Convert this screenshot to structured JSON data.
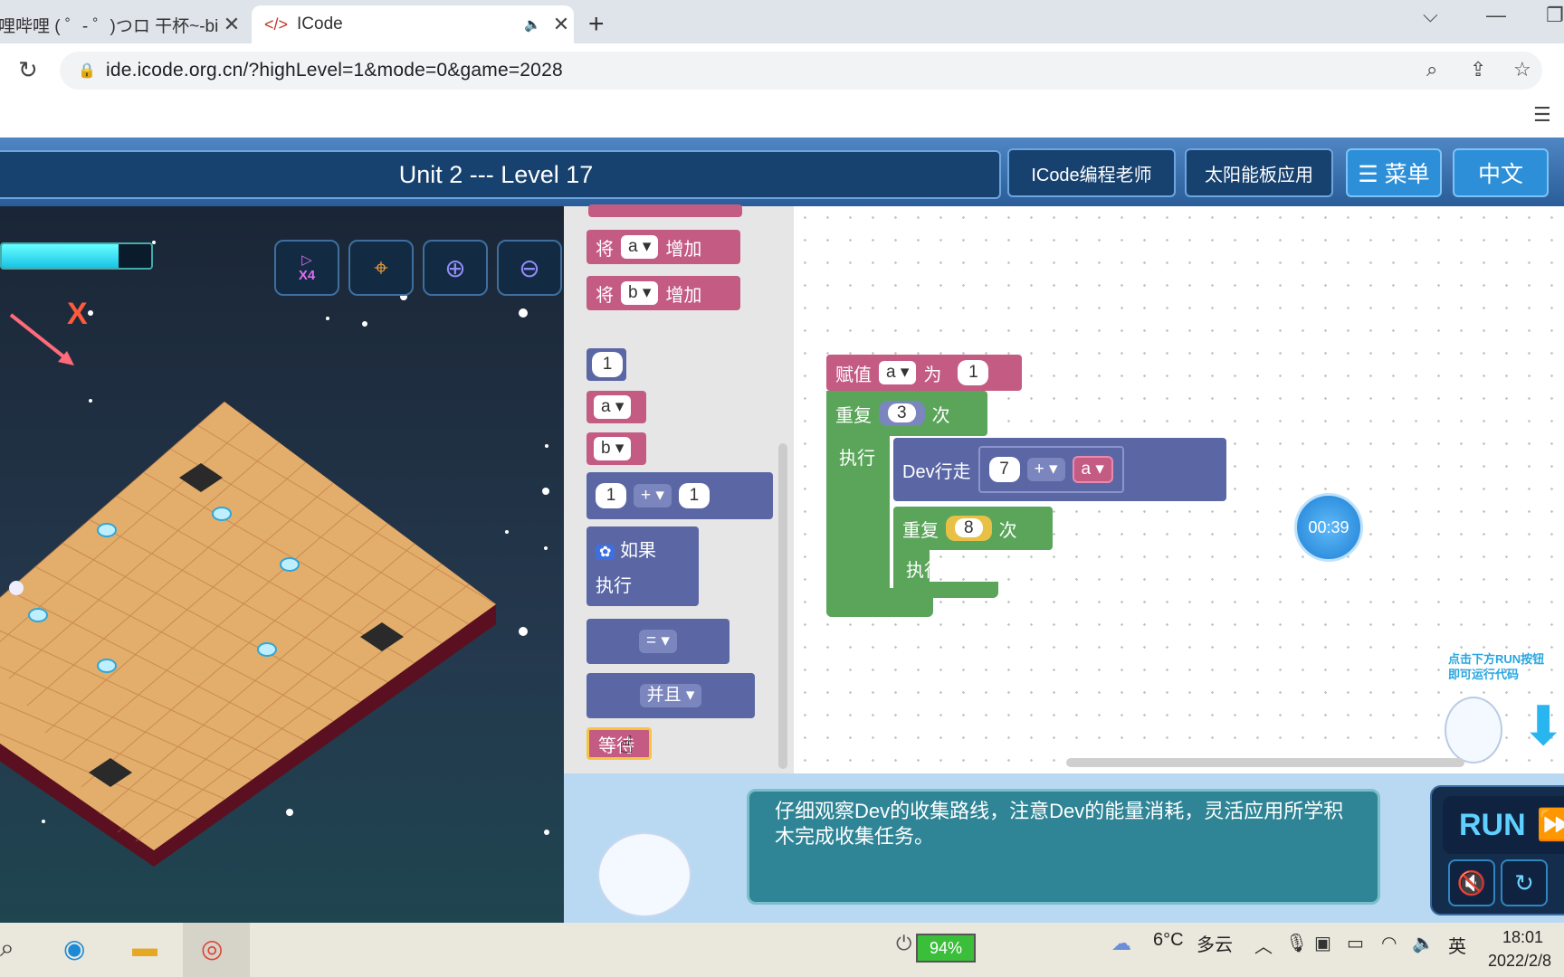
{
  "browser": {
    "tabs": [
      {
        "title": "哩哔哩 ( ゜- ゜)つロ 干杯~-bilil",
        "close": "✕"
      },
      {
        "title": "ICode",
        "close": "✕"
      }
    ],
    "new_tab": "+",
    "url": "ide.icode.org.cn/?highLevel=1&mode=0&game=2028"
  },
  "header": {
    "level_title": "Unit 2 --- Level 17",
    "btn_teacher": "ICode编程老师",
    "btn_solar": "太阳能板应用",
    "btn_menu": "☰ 菜单",
    "btn_lang": "中文"
  },
  "game": {
    "energy_percent": 78,
    "axis_label": "X",
    "buttons": [
      "speed-x4",
      "map",
      "zoom-in",
      "zoom-out"
    ],
    "speed_label": "X4"
  },
  "toolbox": {
    "add_a": {
      "verb": "将",
      "var": "a",
      "action": "增加"
    },
    "add_b": {
      "verb": "将",
      "var": "b",
      "action": "增加"
    },
    "num": "1",
    "var_a": "a",
    "var_b": "b",
    "math": {
      "left": "1",
      "op": "+",
      "right": "1"
    },
    "if_block": {
      "if": "如果",
      "do": "执行"
    },
    "compare_op": "=",
    "logic_op": "并且",
    "wait": "等待"
  },
  "program": {
    "assign": {
      "label": "赋值",
      "var": "a",
      "to": "为",
      "value": "1"
    },
    "repeat_outer": {
      "label": "重复",
      "times": "3",
      "unit": "次",
      "do": "执行"
    },
    "move": {
      "label": "Dev行走",
      "left": "7",
      "op": "+",
      "var": "a"
    },
    "repeat_inner": {
      "label": "重复",
      "times": "8",
      "unit": "次",
      "do": "执行"
    }
  },
  "timer": "00:39",
  "run_hint": [
    "点击下方RUN按钮",
    "即可运行代码"
  ],
  "tip": "仔细观察Dev的收集路线，注意Dev的能量消耗，灵活应用所学积木完成收集任务。",
  "run_button": "RUN",
  "taskbar": {
    "battery": "94%",
    "weather_temp": "6°C",
    "weather_desc": "多云",
    "ime": "英",
    "time": "18:01",
    "date": "2022/2/8"
  },
  "colors": {
    "header_blue": "#2a5d98",
    "block_pink": "#c45b83",
    "block_indigo": "#5b67a5",
    "block_green": "#5ba55b",
    "tip_teal": "#2f8596"
  }
}
